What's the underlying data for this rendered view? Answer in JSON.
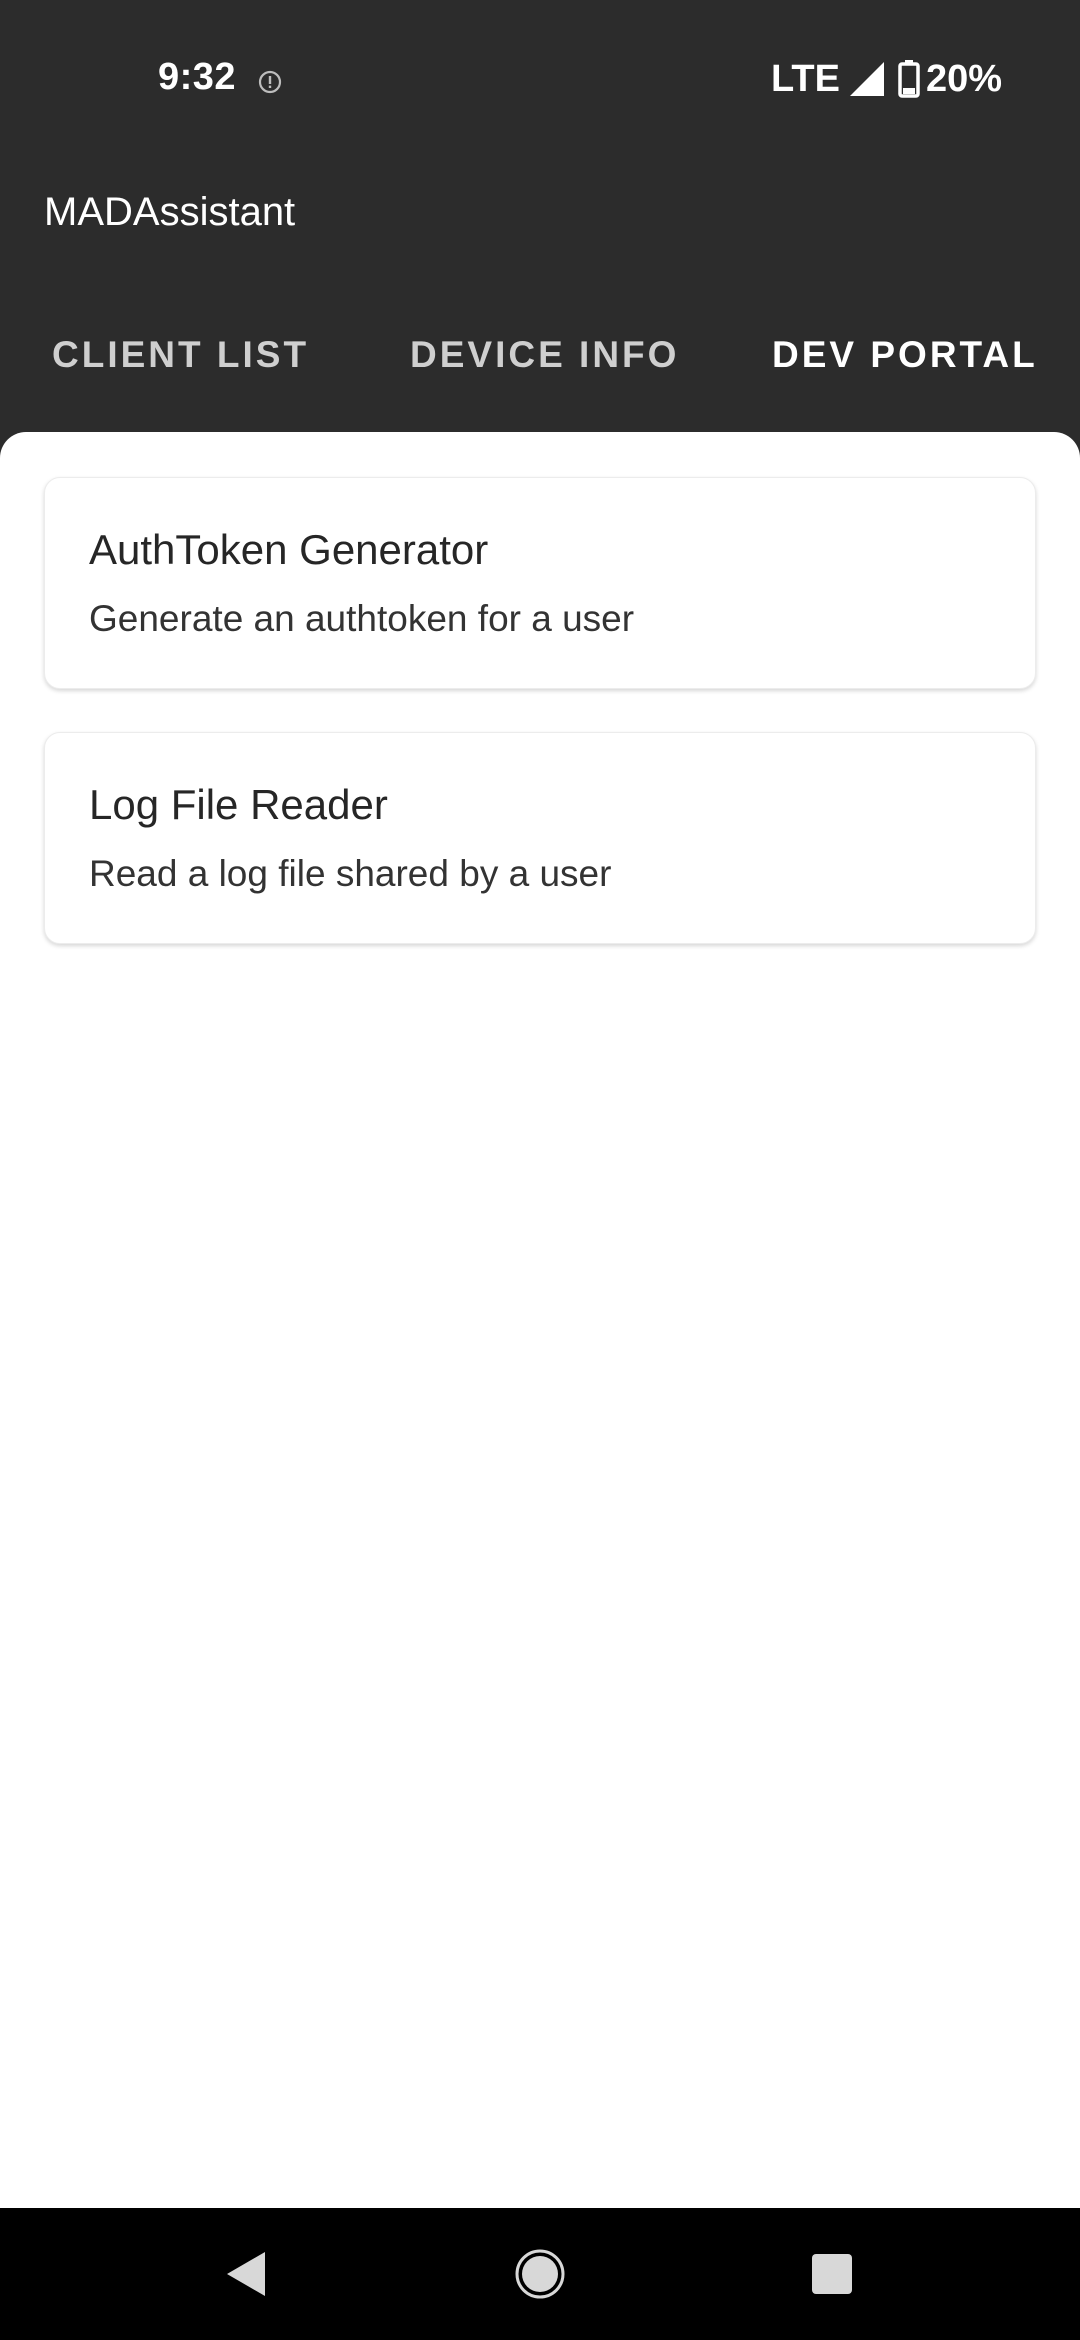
{
  "status_bar": {
    "time": "9:32",
    "network": "LTE",
    "battery": "20%",
    "icons": [
      "alert-icon",
      "signal-icon",
      "battery-icon"
    ]
  },
  "app_bar": {
    "title": "MADAssistant"
  },
  "tabs": [
    {
      "label": "CLIENT LIST",
      "active": false
    },
    {
      "label": "DEVICE INFO",
      "active": false
    },
    {
      "label": "DEV PORTAL",
      "active": true
    }
  ],
  "cards": [
    {
      "title": "AuthToken Generator",
      "subtitle": "Generate an authtoken for a user"
    },
    {
      "title": "Log File Reader",
      "subtitle": "Read a log file shared by a user"
    }
  ],
  "nav_bar": {
    "icons": [
      "back-icon",
      "home-icon",
      "recents-icon"
    ]
  },
  "colors": {
    "app_bar_bg": "#2c2c2c",
    "tab_active": "#ffffff",
    "tab_inactive": "#cfcfcf",
    "content_bg": "#ffffff",
    "nav_bar_bg": "#000000"
  }
}
